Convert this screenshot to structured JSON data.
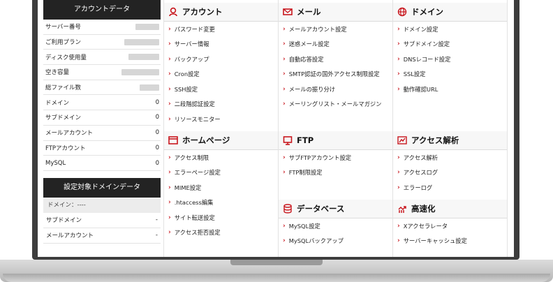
{
  "sidebar": {
    "account_header": "アカウントデータ",
    "rows": [
      {
        "label": "サーバー番号",
        "value": ""
      },
      {
        "label": "ご利用プラン",
        "value": ""
      },
      {
        "label": "ディスク使用量",
        "value": ""
      },
      {
        "label": "空き容量",
        "value": ""
      },
      {
        "label": "総ファイル数",
        "value": ""
      },
      {
        "label": "ドメイン",
        "value": "0"
      },
      {
        "label": "サブドメイン",
        "value": "0"
      },
      {
        "label": "メールアカウント",
        "value": "0"
      },
      {
        "label": "FTPアカウント",
        "value": "0"
      },
      {
        "label": "MySQL",
        "value": "0"
      }
    ],
    "domain_header": "設定対象ドメインデータ",
    "domain_label": "ドメイン：----",
    "domain_rows": [
      {
        "label": "サブドメイン",
        "value": "-"
      },
      {
        "label": "メールアカウント",
        "value": "-"
      }
    ]
  },
  "sections": {
    "account": {
      "title": "アカウント",
      "items": [
        "パスワード変更",
        "サーバー情報",
        "バックアップ",
        "Cron設定",
        "SSH設定",
        "二段階認証設定",
        "リソースモニター"
      ]
    },
    "mail": {
      "title": "メール",
      "items": [
        "メールアカウント設定",
        "迷惑メール設定",
        "自動応答設定",
        "SMTP認証の国外アクセス制限設定",
        "メールの振り分け",
        "メーリングリスト・メールマガジン"
      ]
    },
    "domain": {
      "title": "ドメイン",
      "items": [
        "ドメイン設定",
        "サブドメイン設定",
        "DNSレコード設定",
        "SSL設定",
        "動作確認URL"
      ]
    },
    "homepage": {
      "title": "ホームページ",
      "items": [
        "アクセス制限",
        "エラーページ設定",
        "MIME設定",
        ".htaccess編集",
        "サイト転送設定",
        "アクセス拒否設定"
      ]
    },
    "ftp": {
      "title": "FTP",
      "items": [
        "サブFTPアカウント設定",
        "FTP制限設定"
      ]
    },
    "analytics": {
      "title": "アクセス解析",
      "items": [
        "アクセス解析",
        "アクセスログ",
        "エラーログ"
      ]
    },
    "database": {
      "title": "データベース",
      "items": [
        "MySQL設定",
        "MySQLバックアップ"
      ]
    },
    "speed": {
      "title": "高速化",
      "items": [
        "Xアクセラレータ",
        "サーバーキャッシュ設定"
      ]
    }
  },
  "colors": {
    "accent": "#c8161d",
    "header_dark": "#232323"
  }
}
